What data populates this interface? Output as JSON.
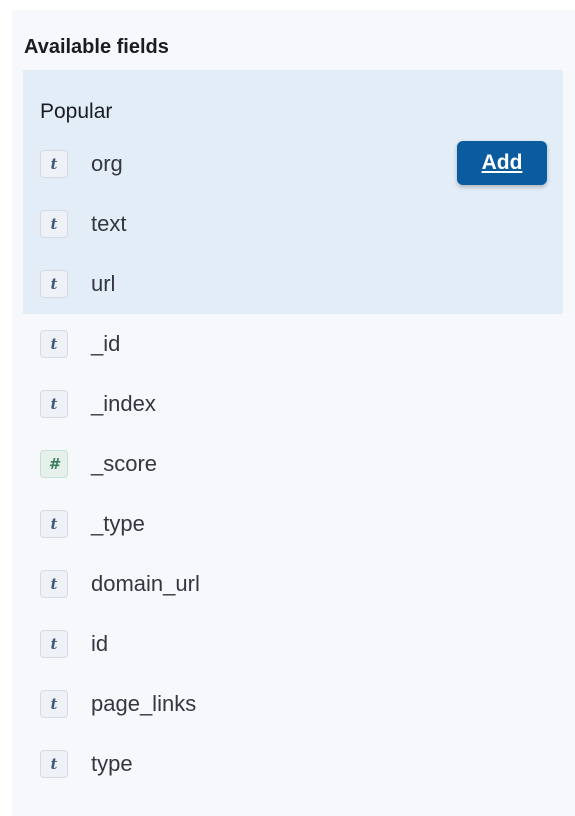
{
  "sidebar": {
    "title": "Available fields",
    "popular": {
      "label": "Popular",
      "fields": [
        {
          "type_icon": "t",
          "name": "org"
        },
        {
          "type_icon": "t",
          "name": "text"
        },
        {
          "type_icon": "t",
          "name": "url"
        }
      ]
    },
    "fields": [
      {
        "type_icon": "t",
        "name": "_id"
      },
      {
        "type_icon": "t",
        "name": "_index"
      },
      {
        "type_icon": "#",
        "name": "_score"
      },
      {
        "type_icon": "t",
        "name": "_type"
      },
      {
        "type_icon": "t",
        "name": "domain_url"
      },
      {
        "type_icon": "t",
        "name": "id"
      },
      {
        "type_icon": "t",
        "name": "page_links"
      },
      {
        "type_icon": "t",
        "name": "type"
      }
    ],
    "add_button_label": "Add"
  },
  "colors": {
    "popular_bg": "#e3edf7",
    "add_button_bg": "#0b5b9f",
    "panel_bg": "#f7f8fc"
  }
}
